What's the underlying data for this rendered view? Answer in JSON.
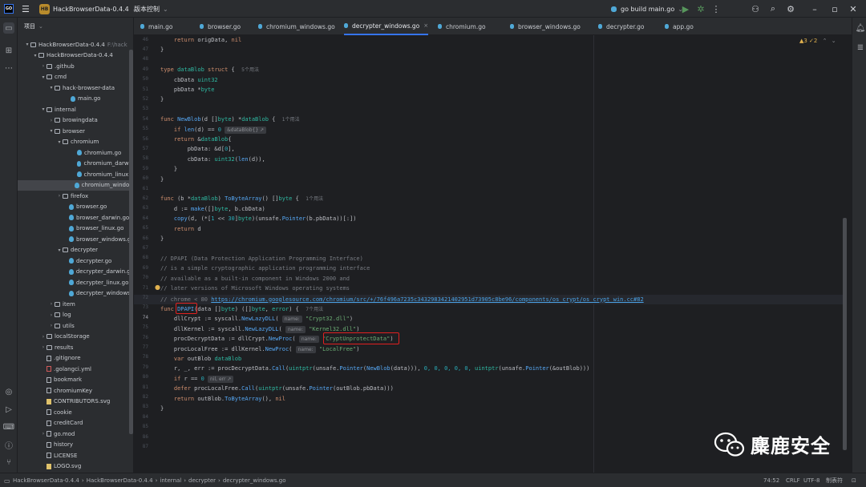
{
  "titlebar": {
    "project_badge": "HB",
    "project_name": "HackBrowserData-0.4.4",
    "vcs_label": "版本控制",
    "run_config": "go build main.go"
  },
  "project_panel": {
    "header": "项目",
    "items": [
      {
        "label": "HackBrowserData-0.4.4",
        "suffix": "F:\\hack",
        "type": "folder",
        "arrow": "▾"
      },
      {
        "label": "HackBrowserData-0.4.4",
        "type": "folder",
        "arrow": "▾"
      },
      {
        "label": ".github",
        "type": "folder",
        "arrow": "›"
      },
      {
        "label": "cmd",
        "type": "folder",
        "arrow": "▾"
      },
      {
        "label": "hack-browser-data",
        "type": "folder",
        "arrow": "▾"
      },
      {
        "label": "main.go",
        "type": "go",
        "arrow": ""
      },
      {
        "label": "internal",
        "type": "folder",
        "arrow": "▾"
      },
      {
        "label": "browingdata",
        "type": "folder",
        "arrow": "›"
      },
      {
        "label": "browser",
        "type": "folder",
        "arrow": "▾"
      },
      {
        "label": "chromium",
        "type": "folder",
        "arrow": "▾"
      },
      {
        "label": "chromium.go",
        "type": "go",
        "arrow": ""
      },
      {
        "label": "chromium_darwin",
        "type": "go",
        "arrow": ""
      },
      {
        "label": "chromium_linux.g",
        "type": "go",
        "arrow": ""
      },
      {
        "label": "chromium_window",
        "type": "go",
        "arrow": ""
      },
      {
        "label": "firefox",
        "type": "folder",
        "arrow": "›"
      },
      {
        "label": "browser.go",
        "type": "go",
        "arrow": ""
      },
      {
        "label": "browser_darwin.go",
        "type": "go",
        "arrow": ""
      },
      {
        "label": "browser_linux.go",
        "type": "go",
        "arrow": ""
      },
      {
        "label": "browser_windows.g",
        "type": "go",
        "arrow": ""
      },
      {
        "label": "decrypter",
        "type": "folder",
        "arrow": "▾"
      },
      {
        "label": "decrypter.go",
        "type": "go",
        "arrow": ""
      },
      {
        "label": "decrypter_darwin.go",
        "type": "go",
        "arrow": ""
      },
      {
        "label": "decrypter_linux.go",
        "type": "go",
        "arrow": ""
      },
      {
        "label": "decrypter_windows.",
        "type": "go",
        "arrow": ""
      },
      {
        "label": "item",
        "type": "folder",
        "arrow": "›"
      },
      {
        "label": "log",
        "type": "folder",
        "arrow": "›"
      },
      {
        "label": "utils",
        "type": "folder",
        "arrow": "›"
      },
      {
        "label": "localStorage",
        "type": "folder",
        "arrow": "›"
      },
      {
        "label": "results",
        "type": "folder",
        "arrow": "›"
      },
      {
        "label": ".gitignore",
        "type": "file",
        "arrow": ""
      },
      {
        "label": ".golangci.yml",
        "type": "yml",
        "arrow": ""
      },
      {
        "label": "bookmark",
        "type": "file",
        "arrow": ""
      },
      {
        "label": "chromiumKey",
        "type": "file",
        "arrow": ""
      },
      {
        "label": "CONTRIBUTORS.svg",
        "type": "svg",
        "arrow": ""
      },
      {
        "label": "cookie",
        "type": "file",
        "arrow": ""
      },
      {
        "label": "creditCard",
        "type": "file",
        "arrow": ""
      },
      {
        "label": "go.mod",
        "type": "file",
        "arrow": "›"
      },
      {
        "label": "history",
        "type": "file",
        "arrow": ""
      },
      {
        "label": "LICENSE",
        "type": "file",
        "arrow": ""
      },
      {
        "label": "LOGO.svg",
        "type": "svg",
        "arrow": ""
      }
    ]
  },
  "tabs": [
    {
      "label": "main.go",
      "close": ""
    },
    {
      "label": "browser.go",
      "close": ""
    },
    {
      "label": "chromium_windows.go",
      "close": ""
    },
    {
      "label": "decrypter_windows.go",
      "close": "×"
    },
    {
      "label": "chromium.go",
      "close": ""
    },
    {
      "label": "browser_windows.go",
      "close": ""
    },
    {
      "label": "decrypter.go",
      "close": ""
    },
    {
      "label": "app.go",
      "close": ""
    }
  ],
  "editor": {
    "warnings": "▲3 ✓2",
    "line_numbers": [
      "46",
      "47",
      "48",
      "49",
      "50",
      "51",
      "52",
      "53",
      "54",
      "55",
      "56",
      "57",
      "58",
      "59",
      "60",
      "61",
      "62",
      "63",
      "64",
      "65",
      "66",
      "67",
      "68",
      "69",
      "70",
      "71",
      "72",
      "73",
      "74",
      "75",
      "76",
      "77",
      "78",
      "79",
      "80",
      "81",
      "82",
      "83",
      "84",
      "85",
      "86",
      "87"
    ],
    "usage_hints": {
      "dataBlob": "5个用法",
      "newBlob": "1个用法",
      "toByteArray": "1个用法",
      "dpapi": "7个用法"
    },
    "inlay_texts": {
      "fold_dataBlob": "&dataBlob{} ↗",
      "name": "name:",
      "fold_nil": "nil, err ↗"
    },
    "strings": {
      "crypt32": "\"Crypt32.dll\"",
      "kernel32": "\"Kernel32.dll\"",
      "cryptUnprotect": "\"CryptUnprotectData\"",
      "localFree": "\"LocalFree\""
    },
    "comments": {
      "c70": "// DPAPI (Data Protection Application Programming Interface)",
      "c71": "// is a simple cryptographic application programming interface",
      "c72": "// available as a built-in component in Windows 2000 and",
      "c73": "// later versions of Microsoft Windows operating systems",
      "c74a": "// chrome < 80 ",
      "c74link": "https://chromium.googlesource.com/chromium/src/+/76f496a7235c3432983421402951d73905c8be96/components/os_crypt/os_crypt_win.cc#82"
    },
    "num_literals": [
      "0",
      "1",
      "30"
    ],
    "zeros": "0, 0, 0, 0, 0,"
  },
  "statusbar": {
    "breadcrumb": [
      "HackBrowserData-0.4.4",
      "HackBrowserData-0.4.4",
      "internal",
      "decrypter",
      "decrypter_windows.go"
    ],
    "position": "74:52",
    "line_ending": "CRLF",
    "encoding": "UTF-8",
    "indent": "制表符"
  },
  "watermark": {
    "text": "麋鹿安全"
  },
  "colors": {
    "accent": "#3574f0",
    "highlight_box": "#e02020",
    "keyword": "#cf8e6d",
    "function": "#56a8f5",
    "string": "#6aab73"
  }
}
